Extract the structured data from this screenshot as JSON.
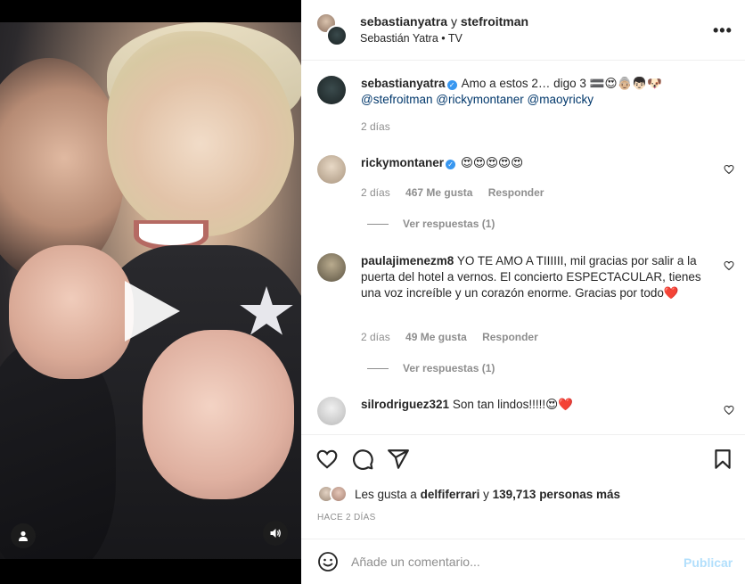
{
  "header": {
    "user1": "sebastianyatra",
    "connector": "y",
    "user2": "stefroitman",
    "audio_artist": "Sebastián Yatra",
    "audio_sep": "•",
    "audio_label": "TV",
    "more_label": "•••"
  },
  "caption": {
    "user": "sebastianyatra",
    "text": "Amo a estos 2… digo 3 🟰😍👵🏼👦🏻🐶",
    "mentions": [
      "@stefroitman",
      "@rickymontaner",
      "@maoyricky"
    ],
    "time": "2 días"
  },
  "comments": [
    {
      "user": "rickymontaner",
      "text": "😍😍😍😍😍",
      "time": "2 días",
      "likes": "467 Me gusta",
      "reply_label": "Responder",
      "view_replies": "Ver respuestas (1)"
    },
    {
      "user": "paulajimenezm8",
      "text": "YO TE AMO A TIIIIII, mil gracias por salir a la puerta del hotel a vernos. El concierto ESPECTACULAR, tienes una voz increíble y un corazón enorme. Gracias por todo❤️",
      "time": "2 días",
      "likes": "49 Me gusta",
      "reply_label": "Responder",
      "view_replies": "Ver respuestas (1)"
    },
    {
      "user": "silrodriguez321",
      "text": "Son tan lindos!!!!!😍❤️"
    }
  ],
  "likes": {
    "prefix": "Les gusta a",
    "first_user": "delfiferrari",
    "connector": "y",
    "count": "139,713 personas más"
  },
  "time_ago": "HACE 2 DÍAS",
  "add_comment": {
    "placeholder": "Añade un comentario...",
    "publish_label": "Publicar"
  },
  "colors": {
    "link": "#00376b",
    "verified": "#3897f0",
    "publish_disabled": "#b2dffc",
    "muted": "#8e8e8e"
  }
}
